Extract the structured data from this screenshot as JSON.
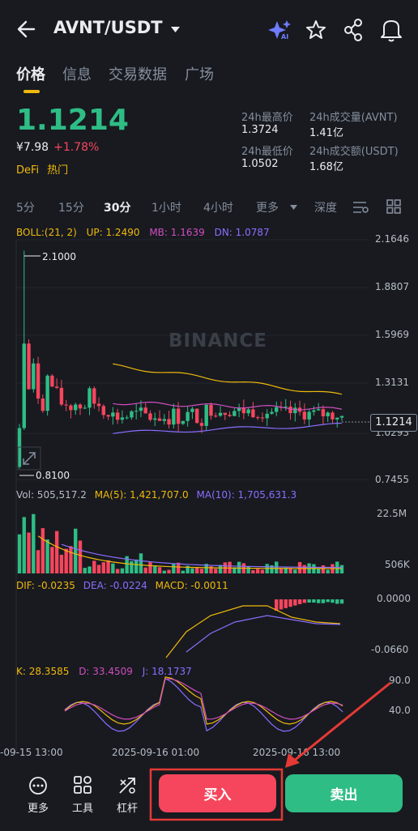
{
  "header": {
    "pair": "AVNT/USDT",
    "ai_badge": "AI"
  },
  "tabs": [
    "价格",
    "信息",
    "交易数据",
    "广场"
  ],
  "price": {
    "last": "1.1214",
    "cny": "¥7.98",
    "change": "+1.78%",
    "tags": [
      "DeFi",
      "热门"
    ]
  },
  "stats": {
    "high_label": "24h最高价",
    "high": "1.3724",
    "vol_label": "24h成交量(AVNT)",
    "vol": "1.41亿",
    "low_label": "24h最低价",
    "low": "1.0502",
    "turnover_label": "24h成交额(USDT)",
    "turnover": "1.68亿"
  },
  "intervals": [
    "5分",
    "15分",
    "30分",
    "1小时",
    "4小时",
    "更多",
    "深度"
  ],
  "main_indicator": {
    "boll": "BOLL:(21, 2)",
    "up": "UP: 1.2490",
    "mb": "MB: 1.1639",
    "dn": "DN: 1.0787"
  },
  "price_axis": [
    "2.1646",
    "1.8807",
    "1.5969",
    "1.3131",
    "1.0293",
    "0.7455"
  ],
  "high_marker": "2.1000",
  "low_marker": "0.8100",
  "price_tag": "1.1214",
  "watermark": "BINANCE",
  "volume": {
    "vol": "Vol: 505,517.2",
    "ma5": "MA(5): 1,421,707.0",
    "ma10": "MA(10): 1,705,631.3",
    "axis_top": "22.5M",
    "axis_bottom": "506K"
  },
  "macd": {
    "dif": "DIF: -0.0235",
    "dea": "DEA: -0.0224",
    "macd": "MACD: -0.0011",
    "axis_top": "0.0000",
    "axis_bottom": "-0.0660"
  },
  "kdj": {
    "k": "K: 28.3585",
    "d": "D: 33.4509",
    "j": "J: 18.1737",
    "axis_top": "90.0",
    "axis_mid": "40.0"
  },
  "time_axis": [
    "-09-15 13:00",
    "2025-09-16 01:00",
    "2025-09-16 13:00"
  ],
  "bottom": {
    "more": "更多",
    "tools": "工具",
    "leverage": "杠杆",
    "buy": "买入",
    "sell": "卖出"
  },
  "colors": {
    "up": "#2ebd85",
    "down": "#f6465d",
    "accent": "#f0b90b",
    "annotation": "#e53935"
  },
  "icons": [
    "back-arrow-icon",
    "dropdown-caret-icon",
    "ai-sparkle-icon",
    "star-icon",
    "share-icon",
    "bell-icon",
    "settings-icon",
    "grid-icon",
    "more-icon",
    "tools-icon",
    "leverage-icon"
  ]
}
